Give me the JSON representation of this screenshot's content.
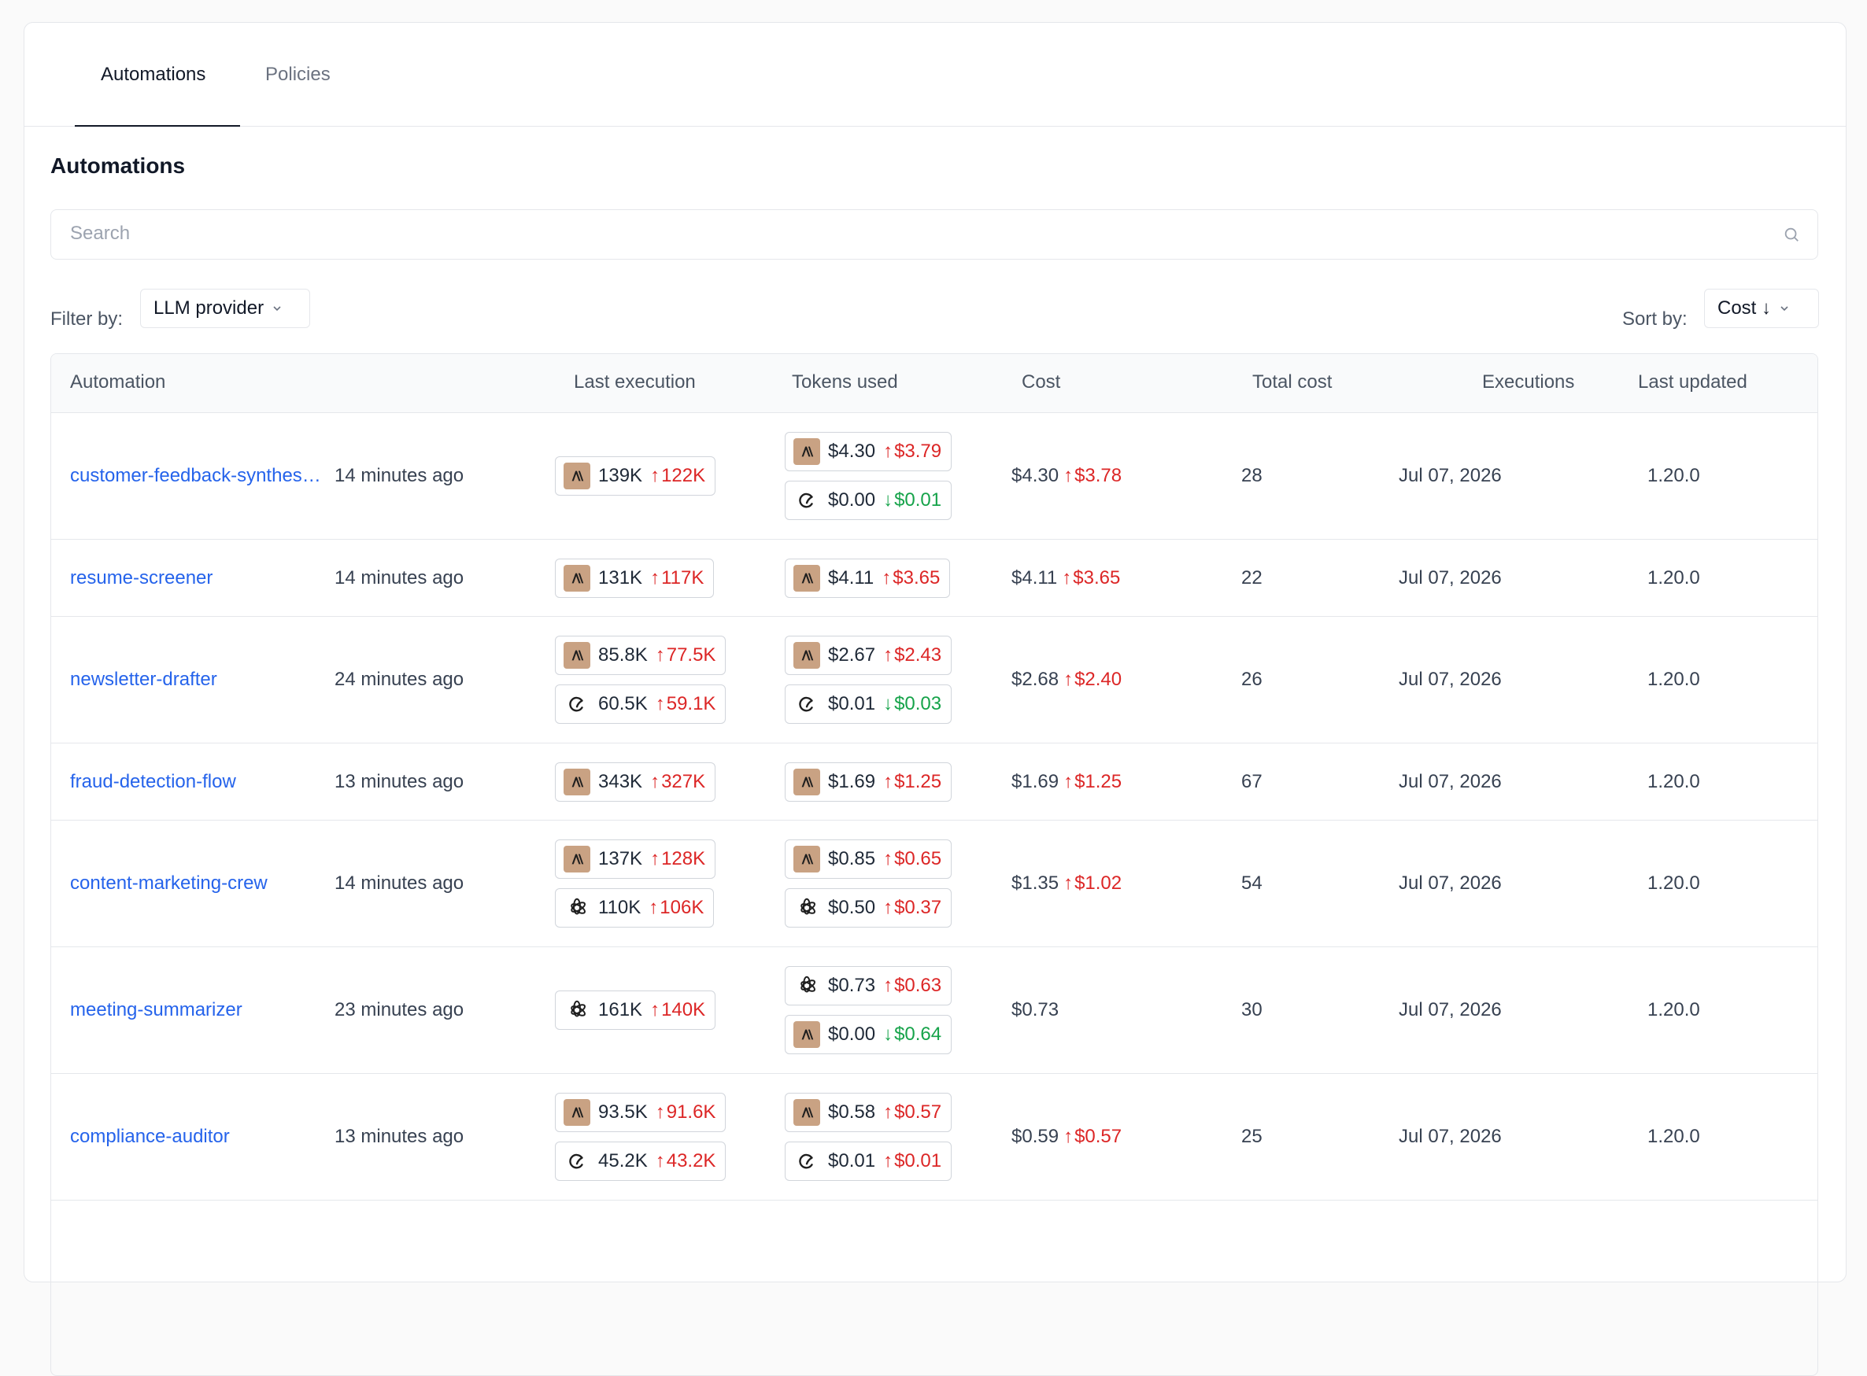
{
  "tabs": [
    {
      "label": "Automations",
      "active": true
    },
    {
      "label": "Policies",
      "active": false
    }
  ],
  "section_title": "Automations",
  "search": {
    "placeholder": "Search",
    "value": ""
  },
  "filter": {
    "label": "Filter by:",
    "value": "LLM provider"
  },
  "sort": {
    "label": "Sort by:",
    "value": "Cost ↓"
  },
  "columns": [
    "Automation",
    "Last execution",
    "Tokens used",
    "Cost",
    "Total cost",
    "Executions",
    "Last updated"
  ],
  "colors": {
    "link": "#2563eb",
    "increase": "#dc2626",
    "decrease": "#16a34a",
    "anthropic_badge": "#c9a283"
  },
  "rows": [
    {
      "name": "customer-feedback-synthesizer",
      "last_execution": "14 minutes ago",
      "tokens": [
        {
          "provider": "anthropic-icon",
          "value": "139K",
          "dir": "up",
          "delta": "122K"
        }
      ],
      "costs": [
        {
          "provider": "anthropic-icon",
          "value": "$4.30",
          "dir": "up",
          "delta": "$3.79"
        },
        {
          "provider": "custom-c-icon",
          "value": "$0.00",
          "dir": "down",
          "delta": "$0.01"
        }
      ],
      "cost_total": {
        "value": "$4.30",
        "dir": "up",
        "delta": "$3.78"
      },
      "executions": "28",
      "date": "Jul 07, 2026",
      "version": "1.20.0"
    },
    {
      "name": "resume-screener",
      "last_execution": "14 minutes ago",
      "tokens": [
        {
          "provider": "anthropic-icon",
          "value": "131K",
          "dir": "up",
          "delta": "117K"
        }
      ],
      "costs": [
        {
          "provider": "anthropic-icon",
          "value": "$4.11",
          "dir": "up",
          "delta": "$3.65"
        }
      ],
      "cost_total": {
        "value": "$4.11",
        "dir": "up",
        "delta": "$3.65"
      },
      "executions": "22",
      "date": "Jul 07, 2026",
      "version": "1.20.0"
    },
    {
      "name": "newsletter-drafter",
      "last_execution": "24 minutes ago",
      "tokens": [
        {
          "provider": "anthropic-icon",
          "value": "85.8K",
          "dir": "up",
          "delta": "77.5K"
        },
        {
          "provider": "custom-c-icon",
          "value": "60.5K",
          "dir": "up",
          "delta": "59.1K"
        }
      ],
      "costs": [
        {
          "provider": "anthropic-icon",
          "value": "$2.67",
          "dir": "up",
          "delta": "$2.43"
        },
        {
          "provider": "custom-c-icon",
          "value": "$0.01",
          "dir": "down",
          "delta": "$0.03"
        }
      ],
      "cost_total": {
        "value": "$2.68",
        "dir": "up",
        "delta": "$2.40"
      },
      "executions": "26",
      "date": "Jul 07, 2026",
      "version": "1.20.0"
    },
    {
      "name": "fraud-detection-flow",
      "last_execution": "13 minutes ago",
      "tokens": [
        {
          "provider": "anthropic-icon",
          "value": "343K",
          "dir": "up",
          "delta": "327K"
        }
      ],
      "costs": [
        {
          "provider": "anthropic-icon",
          "value": "$1.69",
          "dir": "up",
          "delta": "$1.25"
        }
      ],
      "cost_total": {
        "value": "$1.69",
        "dir": "up",
        "delta": "$1.25"
      },
      "executions": "67",
      "date": "Jul 07, 2026",
      "version": "1.20.0"
    },
    {
      "name": "content-marketing-crew",
      "last_execution": "14 minutes ago",
      "tokens": [
        {
          "provider": "anthropic-icon",
          "value": "137K",
          "dir": "up",
          "delta": "128K"
        },
        {
          "provider": "openai-icon",
          "value": "110K",
          "dir": "up",
          "delta": "106K"
        }
      ],
      "costs": [
        {
          "provider": "anthropic-icon",
          "value": "$0.85",
          "dir": "up",
          "delta": "$0.65"
        },
        {
          "provider": "openai-icon",
          "value": "$0.50",
          "dir": "up",
          "delta": "$0.37"
        }
      ],
      "cost_total": {
        "value": "$1.35",
        "dir": "up",
        "delta": "$1.02"
      },
      "executions": "54",
      "date": "Jul 07, 2026",
      "version": "1.20.0"
    },
    {
      "name": "meeting-summarizer",
      "last_execution": "23 minutes ago",
      "tokens": [
        {
          "provider": "openai-icon",
          "value": "161K",
          "dir": "up",
          "delta": "140K"
        }
      ],
      "costs": [
        {
          "provider": "openai-icon",
          "value": "$0.73",
          "dir": "up",
          "delta": "$0.63"
        },
        {
          "provider": "anthropic-icon",
          "value": "$0.00",
          "dir": "down",
          "delta": "$0.64"
        }
      ],
      "cost_total": {
        "value": "$0.73",
        "dir": "",
        "delta": ""
      },
      "executions": "30",
      "date": "Jul 07, 2026",
      "version": "1.20.0"
    },
    {
      "name": "compliance-auditor",
      "last_execution": "13 minutes ago",
      "tokens": [
        {
          "provider": "anthropic-icon",
          "value": "93.5K",
          "dir": "up",
          "delta": "91.6K"
        },
        {
          "provider": "custom-c-icon",
          "value": "45.2K",
          "dir": "up",
          "delta": "43.2K"
        }
      ],
      "costs": [
        {
          "provider": "anthropic-icon",
          "value": "$0.58",
          "dir": "up",
          "delta": "$0.57"
        },
        {
          "provider": "custom-c-icon",
          "value": "$0.01",
          "dir": "up",
          "delta": "$0.01"
        }
      ],
      "cost_total": {
        "value": "$0.59",
        "dir": "up",
        "delta": "$0.57"
      },
      "executions": "25",
      "date": "Jul 07, 2026",
      "version": "1.20.0"
    }
  ]
}
